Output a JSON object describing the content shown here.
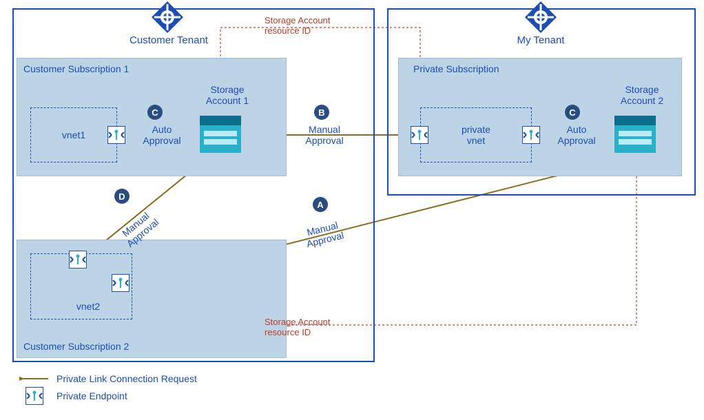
{
  "tenants": {
    "customer": {
      "label": "Customer Tenant"
    },
    "my": {
      "label": "My Tenant"
    }
  },
  "subscriptions": {
    "cust1": {
      "label": "Customer Subscription 1"
    },
    "cust2": {
      "label": "Customer Subscription 2"
    },
    "private": {
      "label": "Private Subscription"
    }
  },
  "vnets": {
    "vnet1": {
      "label": "vnet1"
    },
    "vnet2": {
      "label": "vnet2"
    },
    "private_vnet": {
      "label": "private\nvnet"
    }
  },
  "storage": {
    "s1": {
      "label": "Storage\nAccount 1"
    },
    "s2": {
      "label": "Storage\nAccount 2"
    }
  },
  "connections": {
    "A": {
      "badge": "A",
      "approval": "Manual\nApproval",
      "from": "vnet2.pe2",
      "to": "storage.s2",
      "type": "manual"
    },
    "B": {
      "badge": "B",
      "approval": "Manual\nApproval",
      "from": "private_vnet.pe1",
      "to": "storage.s1",
      "type": "manual"
    },
    "C1": {
      "badge": "C",
      "approval": "Auto\nApproval",
      "from": "vnet1.pe",
      "to": "storage.s1",
      "type": "auto"
    },
    "C2": {
      "badge": "C",
      "approval": "Auto\nApproval",
      "from": "private_vnet.pe2",
      "to": "storage.s2",
      "type": "auto"
    },
    "D": {
      "badge": "D",
      "approval": "Manual\nApproval",
      "from": "vnet2.pe1",
      "to": "storage.s1",
      "type": "manual"
    }
  },
  "resource_id_flows": {
    "top": {
      "label": "Storage Account\nresource ID",
      "from": "storage.s1",
      "to": "private_vnet.pe1"
    },
    "bottom": {
      "label": "Storage Account\nresource ID",
      "from": "storage.s2",
      "to": "vnet2.pe2"
    }
  },
  "legend": {
    "request": "Private Link Connection Request",
    "endpoint": "Private Endpoint"
  },
  "colors": {
    "tenant_border": "#1b4db3",
    "subscription_fill": "#bcd4e6",
    "connection_arrow": "#8a6d1e",
    "resource_id_arrow": "#c0392b",
    "storage_top": "#0d6e8c",
    "storage_body": "#2bb0c9",
    "storage_line": "#b9ecf6"
  }
}
